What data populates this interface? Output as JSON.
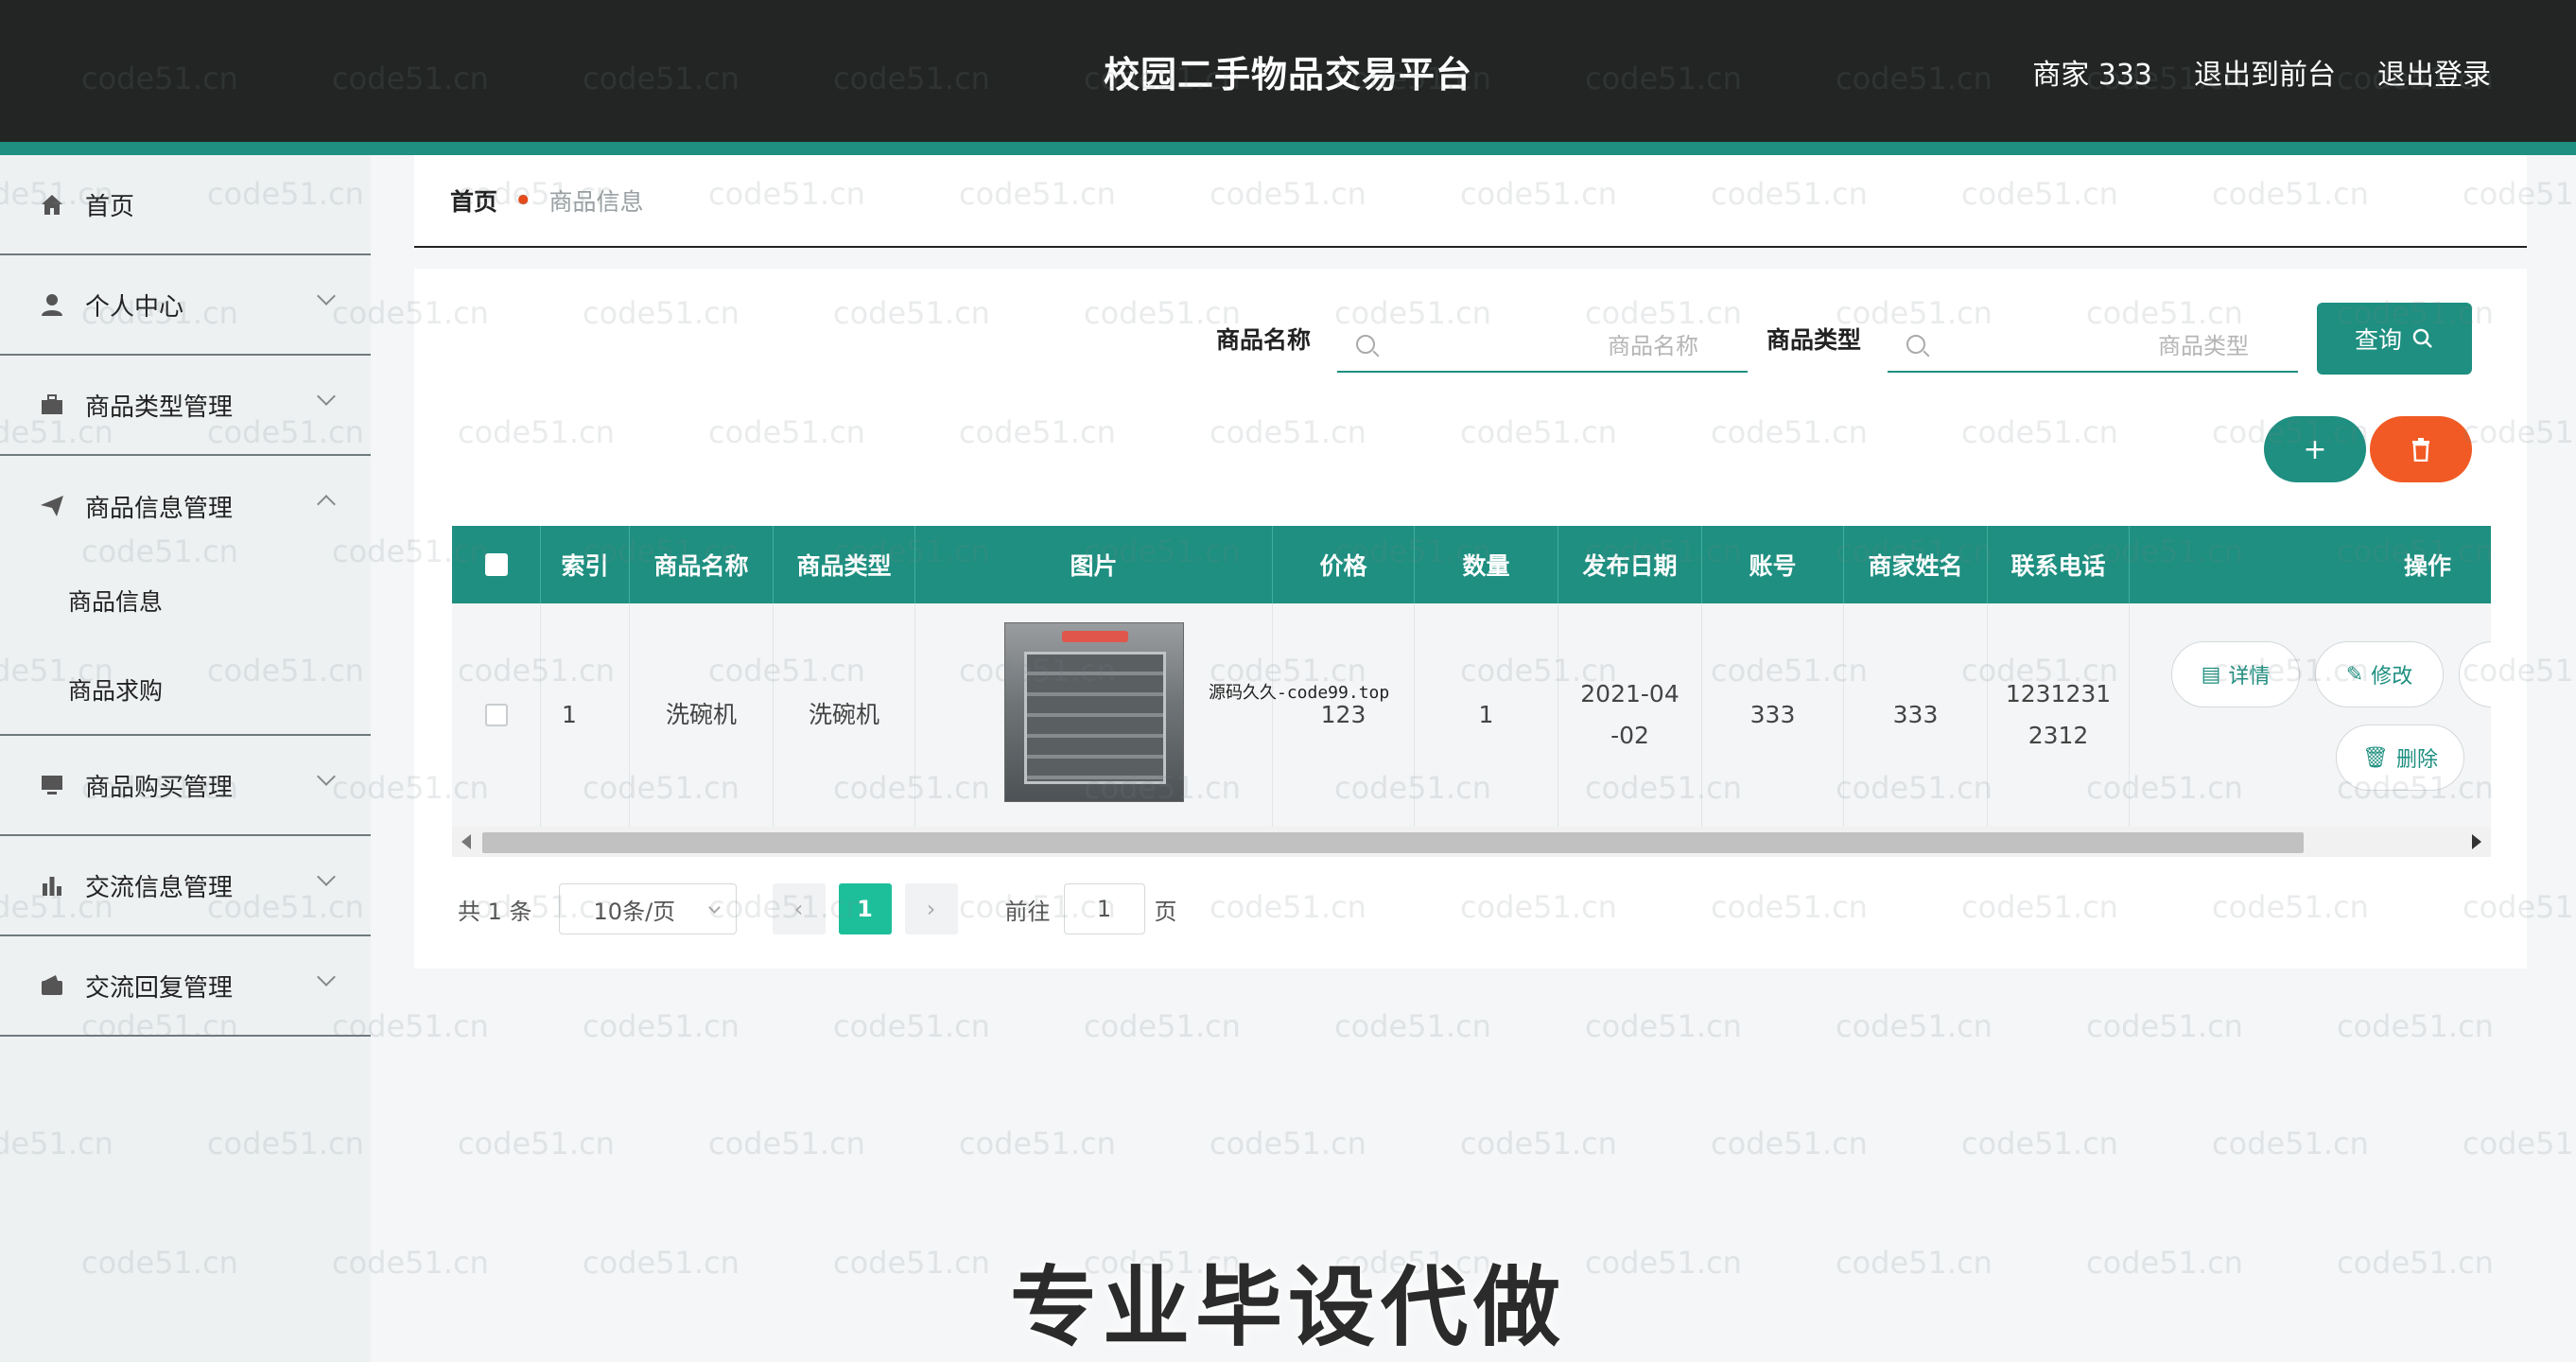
{
  "header": {
    "title": "校园二手物品交易平台",
    "user_label": "商家 333",
    "to_frontend": "退出到前台",
    "logout": "退出登录"
  },
  "sidebar": {
    "items": [
      {
        "label": "首页",
        "icon": "home-icon"
      },
      {
        "label": "个人中心",
        "icon": "user-icon"
      },
      {
        "label": "商品类型管理",
        "icon": "briefcase-icon"
      },
      {
        "label": "商品信息管理",
        "icon": "send-icon",
        "expanded": true,
        "children": [
          "商品信息",
          "商品求购"
        ]
      },
      {
        "label": "商品购买管理",
        "icon": "monitor-icon"
      },
      {
        "label": "交流信息管理",
        "icon": "bar-chart-icon"
      },
      {
        "label": "交流回复管理",
        "icon": "wallet-icon"
      }
    ]
  },
  "breadcrumb": {
    "home": "首页",
    "current": "商品信息"
  },
  "search": {
    "name_label": "商品名称",
    "name_placeholder": "商品名称",
    "type_label": "商品类型",
    "type_placeholder": "商品类型",
    "query_label": "查询"
  },
  "actions": {
    "add_label": "+",
    "colors": {
      "add": "#1e8f80",
      "delete": "#f15a24"
    }
  },
  "table": {
    "headers": [
      "索引",
      "商品名称",
      "商品类型",
      "图片",
      "价格",
      "数量",
      "发布日期",
      "账号",
      "商家姓名",
      "联系电话",
      "操作"
    ],
    "rows": [
      {
        "index": "1",
        "name": "洗碗机",
        "type": "洗碗机",
        "image_caption": "源码久久-code99.top",
        "price": "123",
        "quantity": "1",
        "date_line1": "2021-04",
        "date_line2": "-02",
        "account": "333",
        "merchant": "333",
        "phone_line1": "1231231",
        "phone_line2": "2312",
        "ops": {
          "detail": "详情",
          "edit": "修改",
          "delete": "删除"
        }
      }
    ]
  },
  "pagination": {
    "total": "共 1 条",
    "page_size": "10条/页",
    "current_page": "1",
    "goto_label": "前往",
    "goto_value": "1",
    "page_unit": "页"
  },
  "watermark": "code51.cn",
  "promo_text": "专业毕设代做",
  "theme": {
    "accent": "#1e8f80",
    "header_bg": "#222523",
    "danger": "#f15a24"
  }
}
